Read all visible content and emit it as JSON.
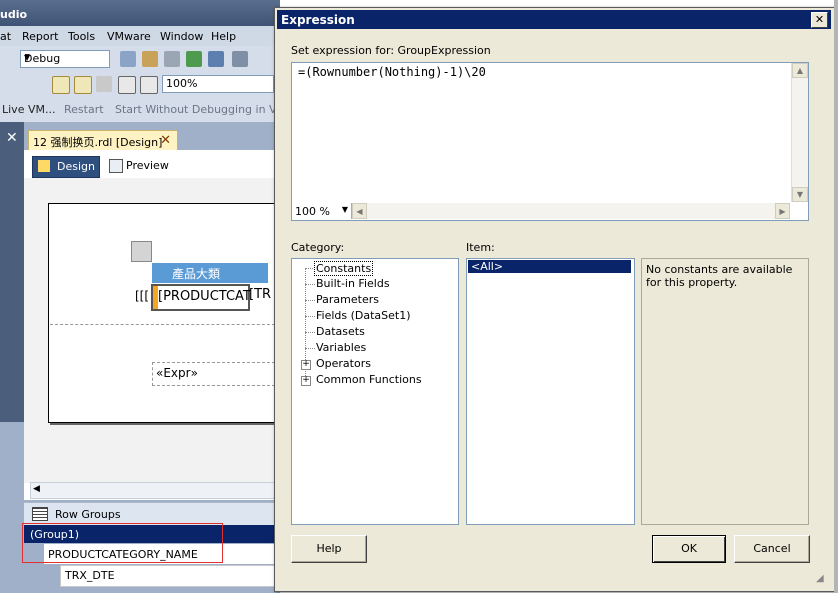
{
  "vs": {
    "title": "udio",
    "menu": [
      "at",
      "Report",
      "Tools",
      "VMware",
      "Window",
      "Help"
    ],
    "config_combo": "Debug",
    "zoom_combo": "100%",
    "vm_toolbar": [
      "Live VM...",
      "Restart",
      "Start Without Debugging in VM"
    ],
    "doc_tab": "12 强制换页.rdl [Design]",
    "tabs": {
      "design": "Design",
      "preview": "Preview"
    },
    "report": {
      "column_header": "產品大類",
      "row_bracket": "[[[",
      "product_cell": "[PRODUCTCAT",
      "next_cell": "[TR",
      "expr_cell": "«Expr»"
    },
    "row_groups": {
      "header": "Row Groups",
      "items": [
        "(Group1)",
        "PRODUCTCATEGORY_NAME",
        "TRX_DTE"
      ]
    }
  },
  "dialog": {
    "title": "Expression",
    "set_expression_label": "Set expression for: GroupExpression",
    "expression": "=(Rownumber(Nothing)-1)\\20",
    "zoom": "100 %",
    "category_label": "Category:",
    "item_label": "Item:",
    "categories": [
      "Constants",
      "Built-in Fields",
      "Parameters",
      "Fields (DataSet1)",
      "Datasets",
      "Variables",
      "Operators",
      "Common Functions"
    ],
    "items": [
      "<All>"
    ],
    "description": "No constants are available for this property.",
    "buttons": {
      "help": "Help",
      "ok": "OK",
      "cancel": "Cancel"
    }
  },
  "colors": {
    "selection": "#0a246a",
    "dialog_bg": "#ece9d8",
    "header_blue": "#5b9bd5",
    "highlight_red": "#e0302f"
  }
}
